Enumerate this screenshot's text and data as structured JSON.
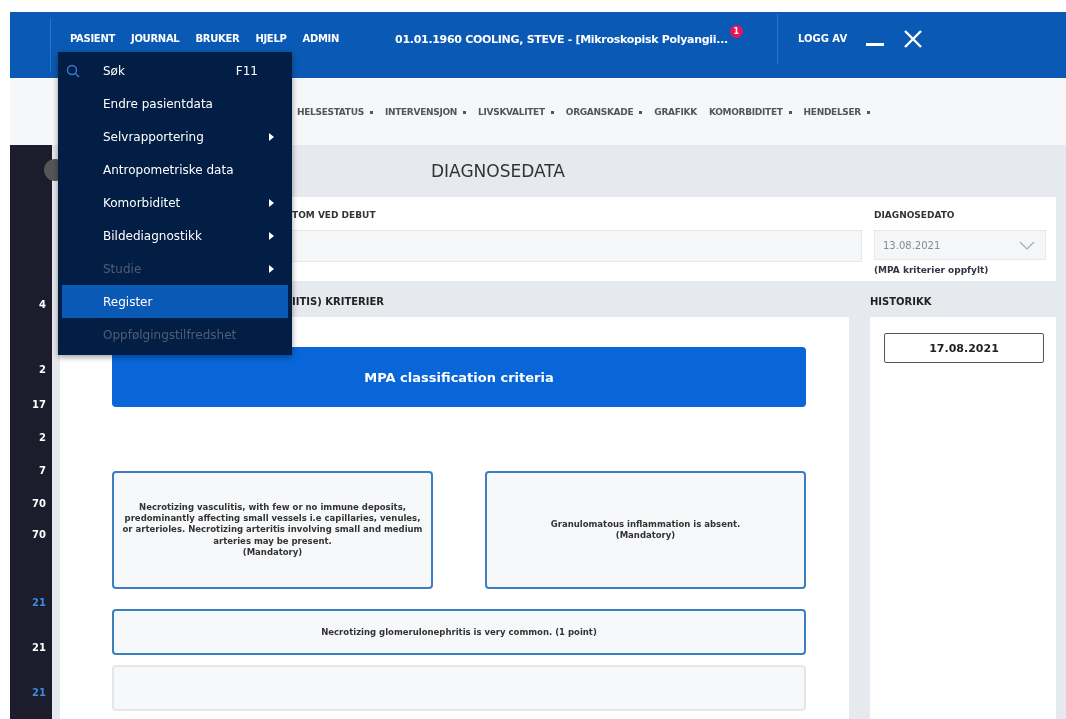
{
  "top_menu": [
    {
      "label": "PASIENT"
    },
    {
      "label": "JOURNAL"
    },
    {
      "label": "BRUKER"
    },
    {
      "label": "HJELP"
    },
    {
      "label": "ADMIN"
    }
  ],
  "patient_title": "01.01.1960 COOLING, STEVE - [Mikroskopisk Polyangii...",
  "notification_count": "1",
  "logout": "LOGG AV",
  "sub_nav": [
    {
      "label": "HELSESTATUS",
      "has_dropdown": true
    },
    {
      "label": "INTERVENSJON",
      "has_dropdown": true
    },
    {
      "label": "LIVSKVALITET",
      "has_dropdown": true
    },
    {
      "label": "ORGANSKADE",
      "has_dropdown": true
    },
    {
      "label": "GRAFIKK",
      "has_dropdown": false
    },
    {
      "label": "KOMORBIDITET",
      "has_dropdown": true
    },
    {
      "label": "HENDELSER",
      "has_dropdown": true
    }
  ],
  "sidebar_values": [
    {
      "text": "4",
      "highlighted": false
    },
    {
      "text": "2",
      "highlighted": false
    },
    {
      "text": "17",
      "highlighted": false
    },
    {
      "text": "2",
      "highlighted": false
    },
    {
      "text": "7",
      "highlighted": false
    },
    {
      "text": "70",
      "highlighted": false
    },
    {
      "text": "70",
      "highlighted": false
    },
    {
      "text": "21",
      "highlighted": true
    },
    {
      "text": "21",
      "highlighted": false
    },
    {
      "text": "21",
      "highlighted": true
    }
  ],
  "dropdown_menu": [
    {
      "label": "Søk",
      "shortcut": "F11",
      "kind": "search",
      "has_submenu": false,
      "disabled": false,
      "selected": false
    },
    {
      "label": "Endre pasientdata",
      "kind": "plain",
      "has_submenu": false,
      "disabled": false,
      "selected": false
    },
    {
      "label": "Selvrapportering",
      "kind": "plain",
      "has_submenu": true,
      "disabled": false,
      "selected": false
    },
    {
      "label": "Antropometriske data",
      "kind": "plain",
      "has_submenu": false,
      "disabled": false,
      "selected": false
    },
    {
      "label": "Komorbiditet",
      "kind": "plain",
      "has_submenu": true,
      "disabled": false,
      "selected": false
    },
    {
      "label": "Bildediagnostikk",
      "kind": "plain",
      "has_submenu": true,
      "disabled": false,
      "selected": false
    },
    {
      "label": "Studie",
      "kind": "plain",
      "has_submenu": true,
      "disabled": true,
      "selected": false
    },
    {
      "label": "Register",
      "kind": "plain",
      "has_submenu": false,
      "disabled": false,
      "selected": true
    },
    {
      "label": "Oppfølgingstilfredshet",
      "kind": "plain",
      "has_submenu": false,
      "disabled": true,
      "selected": false
    }
  ],
  "page_title": "DIAGNOSEDATA",
  "symptom_label": "TOM VED DEBUT",
  "diagnosis_date": {
    "label": "DIAGNOSEDATO",
    "value": "13.08.2021",
    "note": "(MPA kriterier oppfylt)"
  },
  "criteria_heading": "IITIS) KRITERIER",
  "history": {
    "heading": "HISTORIKK",
    "dates": [
      "17.08.2021"
    ]
  },
  "criteria": {
    "banner": "MPA classification criteria",
    "pair": [
      "Necrotizing vasculitis, with few or no immune deposits, predominantly affecting small vessels i.e capillaries, venules, or arterioles. Necrotizing arteritis involving small and medium arteries may be present.\n(Mandatory)",
      "Granulomatous inflammation is absent.\n(Mandatory)"
    ],
    "rows": [
      "Necrotizing glomerulonephritis is very common. (1 point)"
    ]
  }
}
